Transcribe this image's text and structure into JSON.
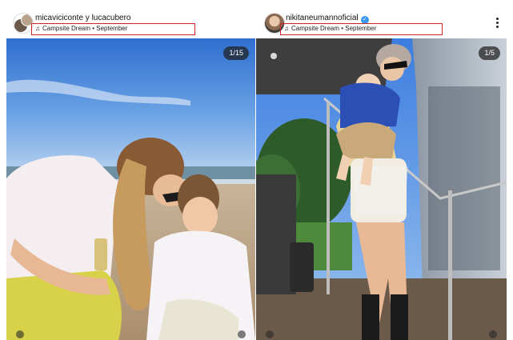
{
  "posts": [
    {
      "username": "micaviciconte y lucacubero",
      "music": "Campsite Dream • September",
      "counter": "1/15",
      "verified": false
    },
    {
      "username": "nikitaneumannoficial",
      "music": "Campsite Dream • September",
      "counter": "1/5",
      "verified": true
    }
  ],
  "icons": {
    "music": "music-note-icon",
    "more": "more-options-icon",
    "verified": "verified-badge-icon"
  },
  "colors": {
    "highlight_box": "#d22424",
    "verified_blue": "#3897f0",
    "counter_bg": "#1e1e1e"
  }
}
